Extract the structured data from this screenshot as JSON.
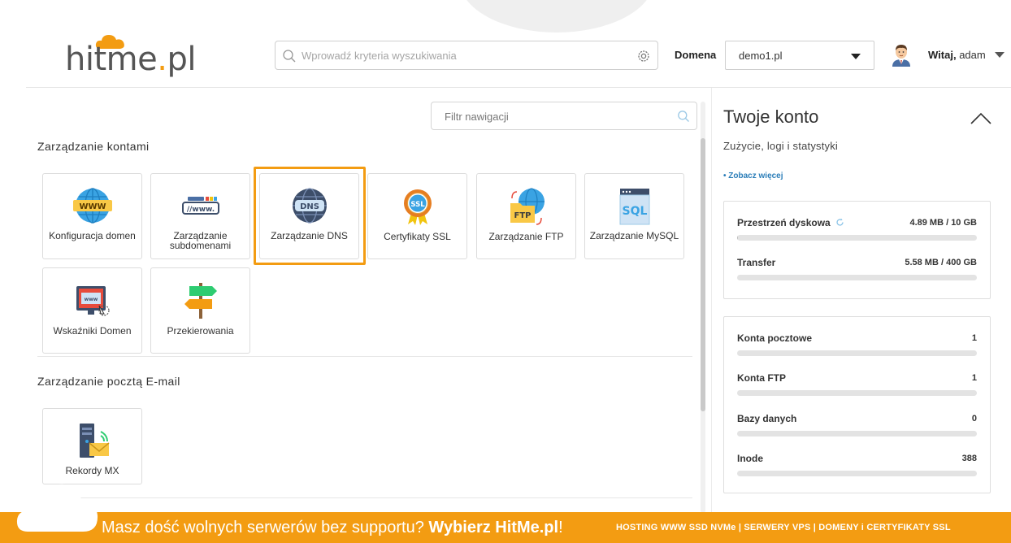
{
  "header": {
    "logo_main": "hitme",
    "logo_accent": ".",
    "logo_tail": "pl",
    "search_placeholder": "Wprowadź kryteria wyszukiwania",
    "domain_label": "Domena",
    "domain_value": "demo1.pl",
    "greeting_bold": "Witaj,",
    "greeting_user": "adam"
  },
  "nav": {
    "filter_placeholder": "Filtr nawigacji",
    "sections": [
      {
        "title": "Zarządzanie kontami",
        "tiles": [
          {
            "label": "Konfiguracja domen",
            "icon": "www-globe-icon"
          },
          {
            "label": "Zarządzanie subdomenami",
            "icon": "subdomain-icon"
          },
          {
            "label": "Zarządzanie DNS",
            "icon": "dns-globe-icon"
          },
          {
            "label": "Certyfikaty SSL",
            "icon": "ssl-badge-icon"
          },
          {
            "label": "Zarządzanie FTP",
            "icon": "ftp-folder-icon"
          },
          {
            "label": "Zarządzanie MySQL",
            "icon": "sql-database-icon"
          },
          {
            "label": "Wskaźniki Domen",
            "icon": "domain-pointer-icon"
          },
          {
            "label": "Przekierowania",
            "icon": "signpost-icon"
          }
        ]
      },
      {
        "title": "Zarządzanie pocztą E-mail",
        "tiles": [
          {
            "label": "Rekordy MX",
            "icon": "mx-record-icon"
          }
        ]
      }
    ]
  },
  "account": {
    "title": "Twoje konto",
    "subtitle": "Zużycie, logi i statystyki",
    "more_link": "• Zobacz więcej",
    "usage": [
      {
        "name": "Przestrzeń dyskowa",
        "value": "4.89 MB / 10 GB",
        "fraction": 0.0005
      },
      {
        "name": "Transfer",
        "value": "5.58 MB / 400 GB",
        "fraction": 0.0
      }
    ],
    "counts": [
      {
        "name": "Konta pocztowe",
        "value": "1"
      },
      {
        "name": "Konta FTP",
        "value": "1"
      },
      {
        "name": "Bazy danych",
        "value": "0"
      },
      {
        "name": "Inode",
        "value": "388"
      }
    ]
  },
  "footer": {
    "message_pre": "Masz dość wolnych serwerów bez supportu?",
    "message_bold": "Wybierz HitMe.pl",
    "message_post": "!",
    "links": "HOSTING WWW SSD NVMe | SERWERY VPS | DOMENY i CERTYFIKATY SSL"
  },
  "colors": {
    "accent": "#f39c12",
    "link": "#2a7db8"
  }
}
